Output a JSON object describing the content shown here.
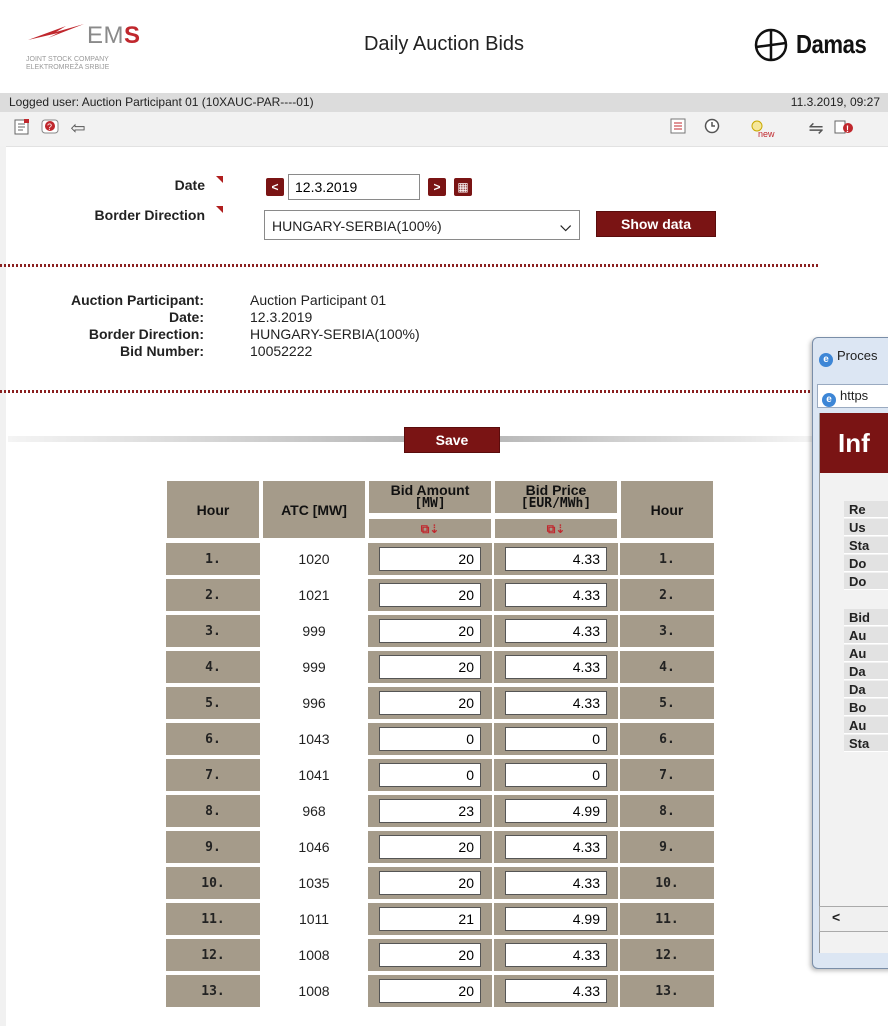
{
  "header": {
    "logo_name_prefix": "EM",
    "logo_name_suffix": "S",
    "logo_sub1": "JOINT STOCK COMPANY",
    "logo_sub2": "ELEKTROMREŽA SRBIJE",
    "title": "Daily Auction Bids",
    "brand": "Damas"
  },
  "userbar": {
    "logged_user": "Logged user: Auction Participant 01 (10XAUC-PAR----01)",
    "datetime": "11.3.2019, 09:27"
  },
  "toolbar": {
    "left_icons": [
      "document-icon",
      "help-icon",
      "back-arrow-icon"
    ],
    "right_icons": [
      "list-icon",
      "clock-icon",
      "new-icon",
      "exchange-icon",
      "alert-icon"
    ]
  },
  "filters": {
    "date_label": "Date",
    "date_value": "12.3.2019",
    "border_label": "Border Direction",
    "border_value": "HUNGARY-SERBIA(100%)",
    "show_button": "Show data"
  },
  "info": {
    "participant_label": "Auction Participant:",
    "participant_value": "Auction Participant 01",
    "date_label": "Date:",
    "date_value": "12.3.2019",
    "border_label": "Border Direction:",
    "border_value": "HUNGARY-SERBIA(100%)",
    "bid_label": "Bid Number:",
    "bid_value": "10052222"
  },
  "save_label": "Save",
  "table": {
    "col_hour": "Hour",
    "col_atc": "ATC [MW]",
    "col_amount_1": "Bid Amount",
    "col_amount_2": "[MW]",
    "col_price_1": "Bid Price",
    "col_price_2": "[EUR/MWh]",
    "col_hour2": "Hour",
    "rows": [
      {
        "hour": "1.",
        "atc": "1020",
        "amount": "20",
        "price": "4.33"
      },
      {
        "hour": "2.",
        "atc": "1021",
        "amount": "20",
        "price": "4.33"
      },
      {
        "hour": "3.",
        "atc": "999",
        "amount": "20",
        "price": "4.33"
      },
      {
        "hour": "4.",
        "atc": "999",
        "amount": "20",
        "price": "4.33"
      },
      {
        "hour": "5.",
        "atc": "996",
        "amount": "20",
        "price": "4.33"
      },
      {
        "hour": "6.",
        "atc": "1043",
        "amount": "0",
        "price": "0"
      },
      {
        "hour": "7.",
        "atc": "1041",
        "amount": "0",
        "price": "0"
      },
      {
        "hour": "8.",
        "atc": "968",
        "amount": "23",
        "price": "4.99"
      },
      {
        "hour": "9.",
        "atc": "1046",
        "amount": "20",
        "price": "4.33"
      },
      {
        "hour": "10.",
        "atc": "1035",
        "amount": "20",
        "price": "4.33"
      },
      {
        "hour": "11.",
        "atc": "1011",
        "amount": "21",
        "price": "4.99"
      },
      {
        "hour": "12.",
        "atc": "1008",
        "amount": "20",
        "price": "4.33"
      },
      {
        "hour": "13.",
        "atc": "1008",
        "amount": "20",
        "price": "4.33"
      }
    ]
  },
  "popup": {
    "title": "Proces",
    "url": "https",
    "heading": "Inf",
    "labels": [
      "Re",
      "Us",
      "Sta",
      "Do",
      "Do",
      "Bid",
      "Au",
      "Au",
      "Da",
      "Da",
      "Bo",
      "Au",
      "Sta"
    ]
  },
  "colors": {
    "accent": "#7a1414",
    "table_header": "#a59b8a",
    "userbar": "#dcdcdc"
  }
}
